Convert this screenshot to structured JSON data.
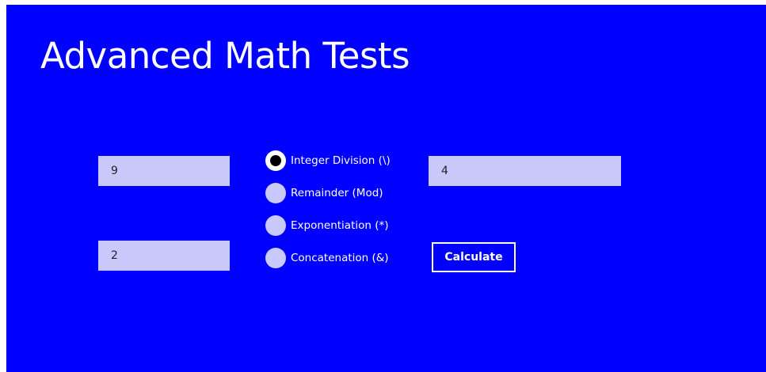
{
  "app": {
    "title": "Advanced Math Tests",
    "background_color": "#0000ff",
    "field_color": "#c8c8fa"
  },
  "inputs": {
    "operand1": "9",
    "operand2": "2",
    "result": "4"
  },
  "operations": [
    {
      "label": "Integer Division (\\)",
      "selected": true
    },
    {
      "label": "Remainder (Mod)",
      "selected": false
    },
    {
      "label": "Exponentiation (*)",
      "selected": false
    },
    {
      "label": "Concatenation (&)",
      "selected": false
    }
  ],
  "actions": {
    "calculate_label": "Calculate"
  }
}
